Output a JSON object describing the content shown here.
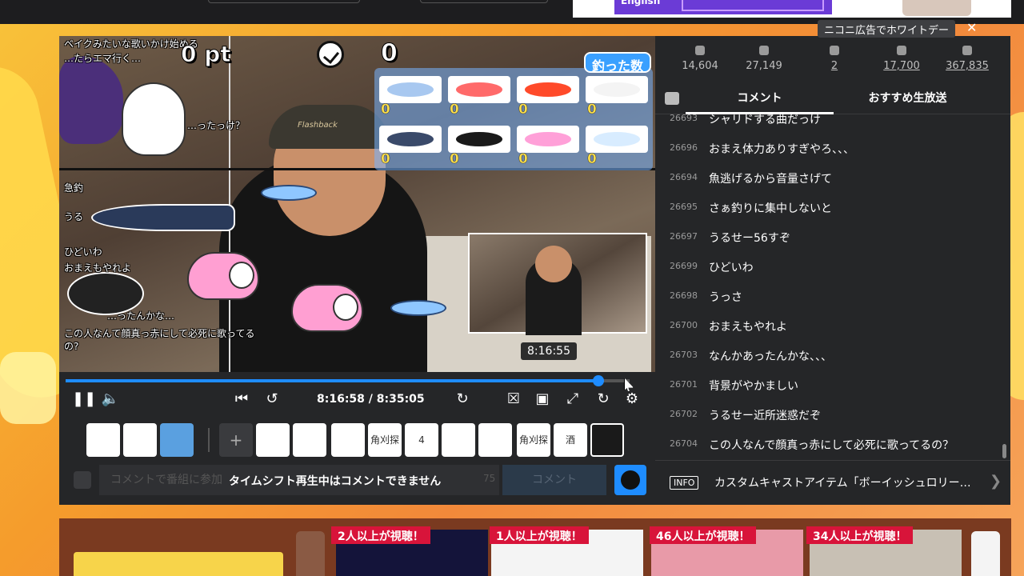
{
  "overlay": {
    "points": "0 pt",
    "checks": "0",
    "catch_title": "釣った数",
    "fish": [
      {
        "count": "0",
        "color": "#a8c8f0"
      },
      {
        "count": "0",
        "color": "#ff6a6a"
      },
      {
        "count": "0",
        "color": "#ff4a2a"
      },
      {
        "count": "0",
        "color": "#f4f4f4"
      },
      {
        "count": "0",
        "color": "#3a4a6a"
      },
      {
        "count": "0",
        "color": "#1a1a1a"
      },
      {
        "count": "0",
        "color": "#ffa0d8"
      },
      {
        "count": "0",
        "color": "#d8ecff"
      }
    ],
    "top_text_1": "ベイクみたいな歌いかけ始める",
    "top_text_2": "…たらエマ行く…",
    "top_text_3": "…ったっけ？",
    "left_texts": [
      "急釣",
      "うる",
      "ひどいわ",
      "おまえもやれよ",
      "…ったんかな…"
    ],
    "bottom_text": "この人なんて顔真っ赤にして必死に歌ってるの?",
    "cap_brand": "Flashback"
  },
  "player": {
    "tooltip_time": "8:16:55",
    "time_display": "8:16:58 / 8:35:05",
    "progress_fraction": 0.944
  },
  "comment_bar": {
    "placeholder": "コメントで番組に参加",
    "notice": "タイムシフト再生中はコメントできません",
    "char_count": "75",
    "button": "コメント"
  },
  "items": [
    {
      "icon": "gift-icon",
      "label": ""
    },
    {
      "icon": "megaphone-icon",
      "label": ""
    },
    {
      "icon": "fishing-icon",
      "label": ""
    },
    {
      "icon": "plus-icon",
      "label": "+"
    },
    {
      "icon": "item-photo-icon",
      "label": ""
    },
    {
      "icon": "item-figure-icon",
      "label": ""
    },
    {
      "icon": "item-lips-icon",
      "label": ""
    },
    {
      "icon": "item-kakusagashi-icon",
      "label": "角刈探し"
    },
    {
      "icon": "item-4-icon",
      "label": "4"
    },
    {
      "icon": "item-grid-icon",
      "label": ""
    },
    {
      "icon": "item-bomb-icon",
      "label": ""
    },
    {
      "icon": "item-kakusagashi2-icon",
      "label": "角刈探し"
    },
    {
      "icon": "item-sake-icon",
      "label": "酒"
    },
    {
      "icon": "item-empty-icon",
      "label": ""
    }
  ],
  "stats": [
    {
      "icon": "viewers-icon",
      "value": "14,604"
    },
    {
      "icon": "comments-icon",
      "value": "27,149"
    },
    {
      "icon": "timeshift-icon",
      "value": "2"
    },
    {
      "icon": "ad-icon",
      "value": "17,700"
    },
    {
      "icon": "gift-icon",
      "value": "367,835"
    }
  ],
  "ad_label": "ニコニ広告でホワイトデー",
  "tabs": {
    "comments": "コメント",
    "recommended": "おすすめ生放送"
  },
  "comments": [
    {
      "num": "26693",
      "text": "シャリドする曲だっけ"
    },
    {
      "num": "26696",
      "text": "おまえ体力ありすぎやろ、、、"
    },
    {
      "num": "26694",
      "text": "魚逃げるから音量さげて"
    },
    {
      "num": "26695",
      "text": "さぁ釣りに集中しないと"
    },
    {
      "num": "26697",
      "text": "うるせー56すぞ"
    },
    {
      "num": "26699",
      "text": "ひどいわ"
    },
    {
      "num": "26698",
      "text": "うっさ"
    },
    {
      "num": "26700",
      "text": "おまえもやれよ"
    },
    {
      "num": "26703",
      "text": "なんかあったんかな、、、"
    },
    {
      "num": "26701",
      "text": "背景がやかましい"
    },
    {
      "num": "26702",
      "text": "うるせー近所迷惑だぞ"
    },
    {
      "num": "26704",
      "text": "この人なんで顔真っ赤にして必死に歌ってるの？"
    }
  ],
  "info": {
    "badge": "INFO",
    "text": "カスタムキャストアイテム「ボーイッシュロリー…"
  },
  "top_ad": {
    "text": "English"
  },
  "recommended": [
    {
      "badge": "2人以上が視聴！"
    },
    {
      "badge": "1人以上が視聴！"
    },
    {
      "badge": "46人以上が視聴！"
    },
    {
      "badge": "34人以上が視聴！"
    }
  ]
}
